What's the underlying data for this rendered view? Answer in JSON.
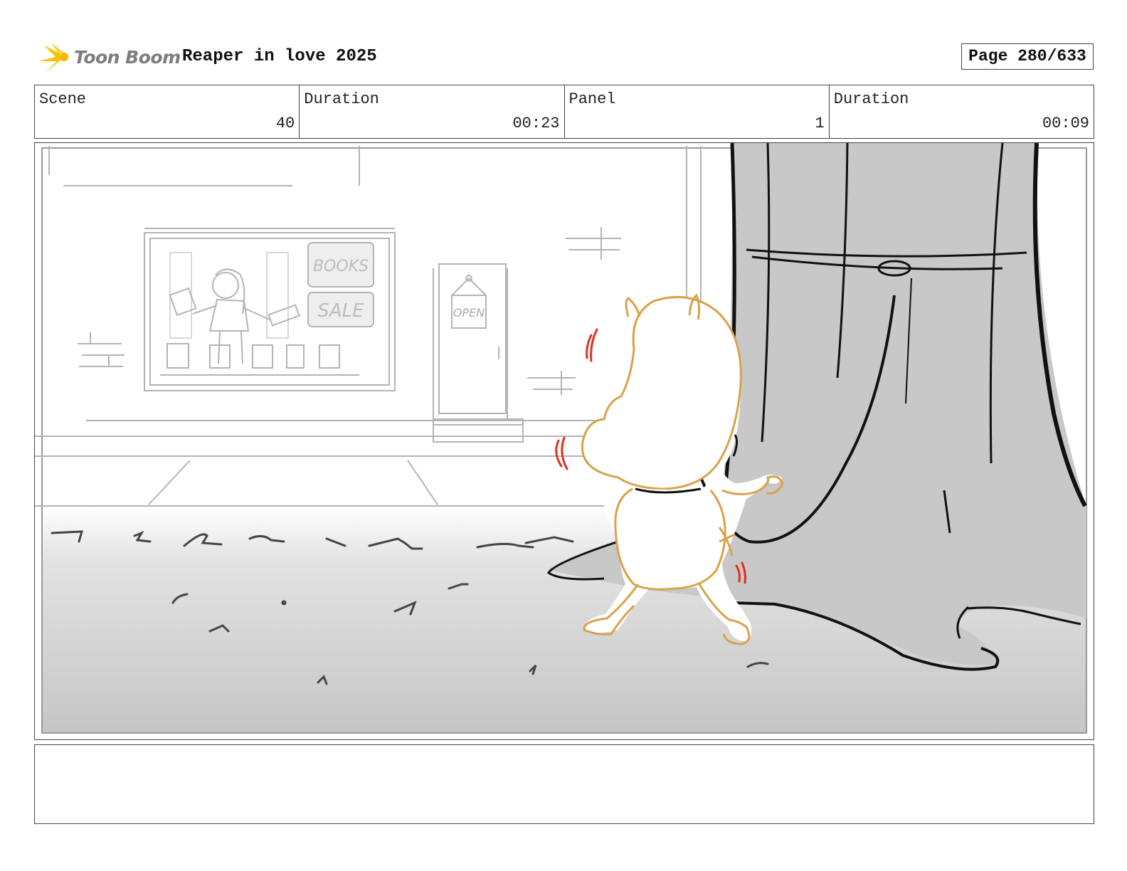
{
  "header": {
    "logo_text": "Toon Boom",
    "project_title": "Reaper in love 2025",
    "page_label": "Page 280/633"
  },
  "info": {
    "scene_label": "Scene",
    "scene_value": "40",
    "scene_duration_label": "Duration",
    "scene_duration_value": "00:23",
    "panel_label": "Panel",
    "panel_value": "1",
    "panel_duration_label": "Duration",
    "panel_duration_value": "00:09"
  },
  "panel": {
    "sign_books": "BOOKS",
    "sign_sale": "SALE",
    "door_sign": "OPEN"
  },
  "notes": {
    "text": ""
  },
  "colors": {
    "logo_yellow": "#f5c400",
    "character_outline": "#d9a24a",
    "motion_lines": "#e03020",
    "tree_fill": "#c8c8c8",
    "sketch_gray": "#b4b4b4"
  }
}
